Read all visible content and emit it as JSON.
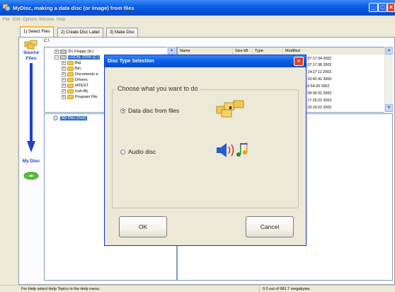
{
  "window": {
    "title": "MyDisc, making a data disc (or image) from files"
  },
  "menu": [
    "File",
    "Edit",
    "Options",
    "Window",
    "Help"
  ],
  "tabs": [
    {
      "label": "1) Select Files",
      "active": true
    },
    {
      "label": "2) Create Disc Label",
      "active": false
    },
    {
      "label": "3) Make Disc",
      "active": false
    }
  ],
  "sidebar": {
    "source_label": "Source Files",
    "target_label": "My Disc"
  },
  "path": "C:\\",
  "tree": [
    {
      "label": "3½ Floppy (A:)",
      "kind": "drive",
      "expand": "+"
    },
    {
      "label": "LOCAL DISK (C:)",
      "kind": "drive",
      "expand": "−",
      "selected": true
    },
    {
      "label": "Bat",
      "kind": "folder",
      "expand": "+"
    },
    {
      "label": "Bin",
      "kind": "folder",
      "expand": "+"
    },
    {
      "label": "Documents a",
      "kind": "folder",
      "expand": "+"
    },
    {
      "label": "Drivers",
      "kind": "folder",
      "expand": "+"
    },
    {
      "label": "IATEST",
      "kind": "folder",
      "expand": "+"
    },
    {
      "label": "Icsh-Mj",
      "kind": "folder",
      "expand": "+"
    },
    {
      "label": "Program File",
      "kind": "folder",
      "expand": "+"
    }
  ],
  "filelist": {
    "columns": [
      "Name",
      "Size kB",
      "Type",
      "Modified"
    ],
    "modified": [
      "27 07:17:34 2002",
      "27 07:17:38 2002",
      "04 14:27:11 2003",
      "27 10:42:41 2003",
      "1 16:54:30 2002",
      "06 09:39:31 2003",
      "03 17:25:22 2003",
      "03 03:19:22 2002"
    ]
  },
  "disc_tree": {
    "root_label": "My Disc (root)"
  },
  "status": {
    "help": "For Help select Help Topics in the Help menu.",
    "capacity": "0.0 out of   681.7 megabytes"
  },
  "dialog": {
    "title": "Disc Type Selection",
    "group_label": "Choose what you want to do",
    "options": [
      {
        "label": "Data disc from files",
        "selected": true,
        "icon": "data-files-icon"
      },
      {
        "label": "Audio disc",
        "selected": false,
        "icon": "audio-disc-icon"
      }
    ],
    "ok_label": "OK",
    "cancel_label": "Cancel"
  },
  "colors": {
    "xp_blue": "#0552d8",
    "selection": "#316ac5",
    "close_red": "#d9442c"
  }
}
